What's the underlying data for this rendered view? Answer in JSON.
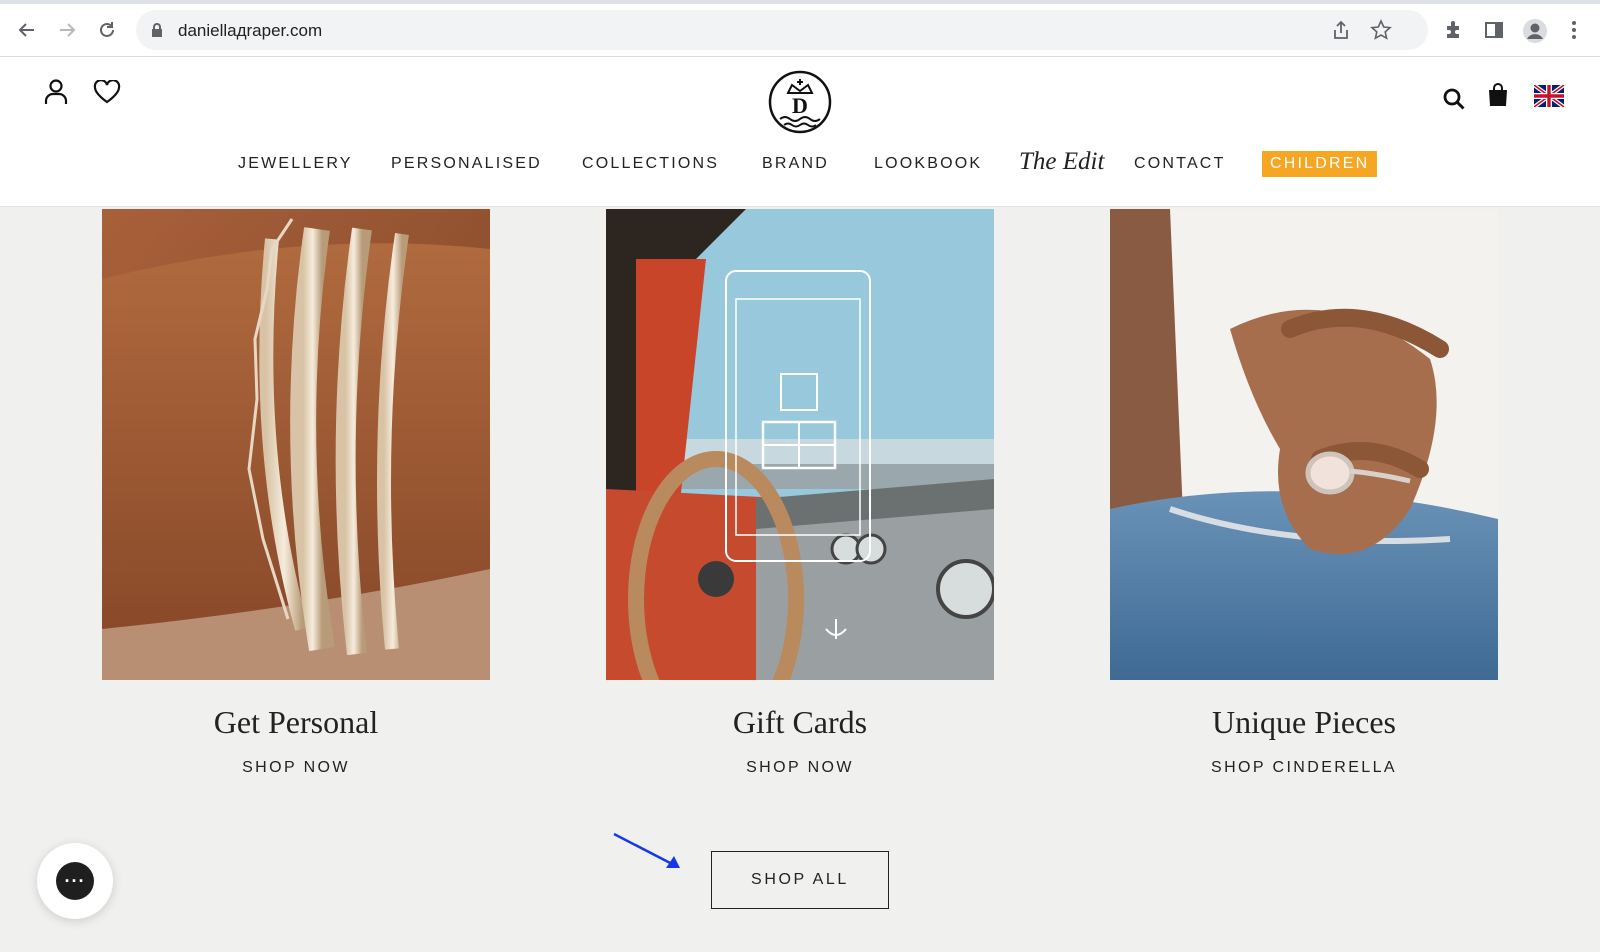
{
  "browser": {
    "url": "daniellадraper.com",
    "icons": [
      "back-icon",
      "forward-icon",
      "reload-icon",
      "lock-icon",
      "share-icon",
      "star-icon",
      "extensions-icon",
      "sidepanel-icon",
      "profile-icon",
      "more-icon"
    ]
  },
  "header": {
    "left_icons": [
      "account-icon",
      "wishlist-icon"
    ],
    "right_icons": [
      "search-icon",
      "bag-icon",
      "uk-flag-icon"
    ],
    "menu": [
      {
        "label": "JEWELLERY"
      },
      {
        "label": "PERSONALISED"
      },
      {
        "label": "COLLECTIONS"
      },
      {
        "label": "BRAND"
      },
      {
        "label": "LOOKBOOK"
      },
      {
        "label": "The Edit"
      },
      {
        "label": "CONTACT"
      },
      {
        "label": "CHILDREN"
      }
    ],
    "children_color": "#f5a623"
  },
  "cards": [
    {
      "title": "Get Personal",
      "link": "SHOP NOW"
    },
    {
      "title": "Gift Cards",
      "link": "SHOP NOW"
    },
    {
      "title": "Unique Pieces",
      "link": "SHOP CINDERELLA"
    }
  ],
  "shop_all": "SHOP ALL",
  "chat_icon": "chat-icon"
}
